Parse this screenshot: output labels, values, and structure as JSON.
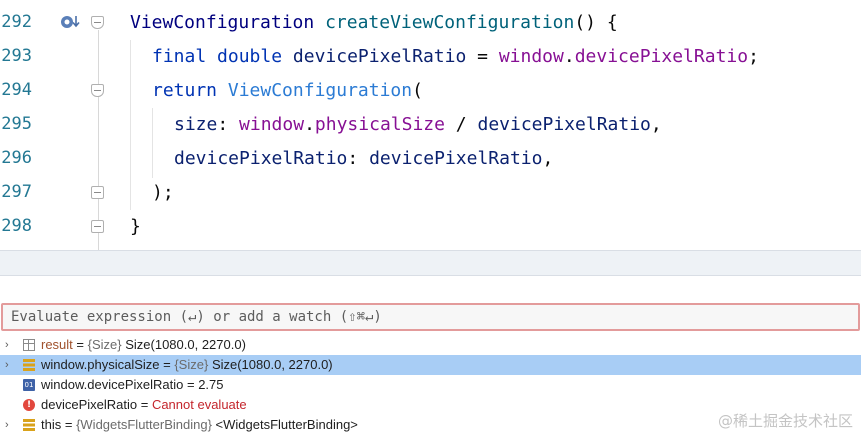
{
  "editor": {
    "lines": [
      {
        "number": "292",
        "tokens": [
          [
            "type",
            "ViewConfiguration"
          ],
          [
            "plain",
            " "
          ],
          [
            "fn",
            "createViewConfiguration"
          ],
          [
            "plain",
            "() {"
          ]
        ]
      },
      {
        "number": "293",
        "tokens": [
          [
            "kw",
            "final"
          ],
          [
            "plain",
            " "
          ],
          [
            "kw",
            "double"
          ],
          [
            "plain",
            " "
          ],
          [
            "param",
            "devicePixelRatio"
          ],
          [
            "plain",
            " = "
          ],
          [
            "obj",
            "window"
          ],
          [
            "plain",
            "."
          ],
          [
            "obj",
            "devicePixelRatio"
          ],
          [
            "plain",
            ";"
          ]
        ]
      },
      {
        "number": "294",
        "tokens": [
          [
            "kw",
            "return"
          ],
          [
            "plain",
            " "
          ],
          [
            "call",
            "ViewConfiguration"
          ],
          [
            "plain",
            "("
          ]
        ]
      },
      {
        "number": "295",
        "tokens": [
          [
            "param",
            "size"
          ],
          [
            "plain",
            ": "
          ],
          [
            "obj",
            "window"
          ],
          [
            "plain",
            "."
          ],
          [
            "obj",
            "physicalSize"
          ],
          [
            "plain",
            " / "
          ],
          [
            "param",
            "devicePixelRatio"
          ],
          [
            "plain",
            ","
          ]
        ]
      },
      {
        "number": "296",
        "tokens": [
          [
            "param",
            "devicePixelRatio"
          ],
          [
            "plain",
            ": "
          ],
          [
            "param",
            "devicePixelRatio"
          ],
          [
            "plain",
            ","
          ]
        ]
      },
      {
        "number": "297",
        "tokens": [
          [
            "plain",
            ");"
          ]
        ]
      },
      {
        "number": "298",
        "tokens": [
          [
            "plain",
            "}"
          ]
        ]
      }
    ]
  },
  "debugger": {
    "evaluate_placeholder": "Evaluate expression (↵) or add a watch (⇧⌘↵)",
    "variables": [
      {
        "name": "result",
        "eq": " = ",
        "type": "{Size}",
        "value": " Size(1080.0, 2270.0)",
        "expander": "›",
        "icon": "table-icon"
      },
      {
        "name": "window.physicalSize",
        "eq": " = ",
        "type": "{Size}",
        "value": " Size(1080.0, 2270.0)",
        "expander": "›",
        "icon": "stack-icon"
      },
      {
        "name": "window.devicePixelRatio",
        "eq": " = ",
        "type": "",
        "value": "2.75",
        "expander": "",
        "icon": "primitive-icon"
      },
      {
        "name": "devicePixelRatio",
        "eq": " = ",
        "type": "",
        "value": "Cannot evaluate",
        "expander": "",
        "icon": "error-icon"
      },
      {
        "name": "this",
        "eq": " = ",
        "type": "{WidgetsFlutterBinding}",
        "value": " <WidgetsFlutterBinding>",
        "expander": "›",
        "icon": "stack-icon"
      }
    ],
    "primitive_icon_text": "01",
    "error_icon_text": "!"
  },
  "watermark": "@稀土掘金技术社区"
}
